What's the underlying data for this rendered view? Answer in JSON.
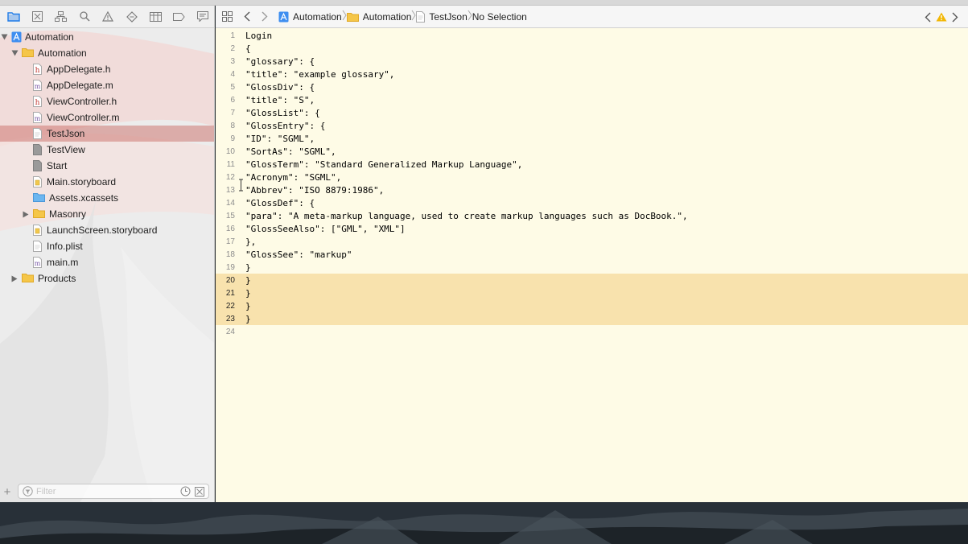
{
  "navigator": {
    "toolbar": [
      "project-navigator-icon",
      "source-control-icon",
      "symbol-navigator-icon",
      "find-icon",
      "issue-warning-icon",
      "test-diamond-icon",
      "debug-icon",
      "breakpoint-icon",
      "report-icon"
    ],
    "tree": [
      {
        "label": "Automation",
        "indent": 0,
        "icon": "project",
        "disclosure": "open"
      },
      {
        "label": "Automation",
        "indent": 1,
        "icon": "folder",
        "disclosure": "open"
      },
      {
        "label": "AppDelegate.h",
        "indent": 2,
        "icon": "h"
      },
      {
        "label": "AppDelegate.m",
        "indent": 2,
        "icon": "m"
      },
      {
        "label": "ViewController.h",
        "indent": 2,
        "icon": "h"
      },
      {
        "label": "ViewController.m",
        "indent": 2,
        "icon": "m"
      },
      {
        "label": "TestJson",
        "indent": 2,
        "icon": "doc",
        "selected": true
      },
      {
        "label": "TestView",
        "indent": 2,
        "icon": "gray"
      },
      {
        "label": "Start",
        "indent": 2,
        "icon": "gray"
      },
      {
        "label": "Main.storyboard",
        "indent": 2,
        "icon": "storyboard"
      },
      {
        "label": "Assets.xcassets",
        "indent": 2,
        "icon": "bluefolder"
      },
      {
        "label": "Masonry",
        "indent": 2,
        "icon": "folder",
        "disclosure": "closed"
      },
      {
        "label": "LaunchScreen.storyboard",
        "indent": 2,
        "icon": "storyboard"
      },
      {
        "label": "Info.plist",
        "indent": 2,
        "icon": "doc"
      },
      {
        "label": "main.m",
        "indent": 2,
        "icon": "m"
      },
      {
        "label": "Products",
        "indent": 1,
        "icon": "folder",
        "disclosure": "closed"
      }
    ],
    "filter": {
      "placeholder": "Filter",
      "add_label": "+"
    }
  },
  "jumpbar": {
    "crumbs": [
      {
        "label": "Automation",
        "icon": "project"
      },
      {
        "label": "Automation",
        "icon": "folder"
      },
      {
        "label": "TestJson",
        "icon": "doc"
      },
      {
        "label": "No Selection",
        "icon": ""
      }
    ]
  },
  "editor": {
    "lines": [
      {
        "n": "1",
        "text": "Login"
      },
      {
        "n": "2",
        "text": "{"
      },
      {
        "n": "3",
        "text": "\"glossary\": {"
      },
      {
        "n": "4",
        "text": "\"title\": \"example glossary\","
      },
      {
        "n": "5",
        "text": "\"GlossDiv\": {"
      },
      {
        "n": "6",
        "text": "\"title\": \"S\","
      },
      {
        "n": "7",
        "text": "\"GlossList\": {"
      },
      {
        "n": "8",
        "text": "\"GlossEntry\": {"
      },
      {
        "n": "9",
        "text": "\"ID\": \"SGML\","
      },
      {
        "n": "10",
        "text": "\"SortAs\": \"SGML\","
      },
      {
        "n": "11",
        "text": "\"GlossTerm\": \"Standard Generalized Markup Language\","
      },
      {
        "n": "12",
        "text": "\"Acronym\": \"SGML\","
      },
      {
        "n": "13",
        "text": "\"Abbrev\": \"ISO 8879:1986\","
      },
      {
        "n": "14",
        "text": "\"GlossDef\": {"
      },
      {
        "n": "15",
        "text": "\"para\": \"A meta-markup language, used to create markup languages such as DocBook.\","
      },
      {
        "n": "16",
        "text": "\"GlossSeeAlso\": [\"GML\", \"XML\"]"
      },
      {
        "n": "17",
        "text": "},"
      },
      {
        "n": "18",
        "text": "\"GlossSee\": \"markup\""
      },
      {
        "n": "19",
        "text": "}"
      },
      {
        "n": "20",
        "text": "}",
        "hl": true
      },
      {
        "n": "21",
        "text": "}",
        "hl": true
      },
      {
        "n": "22",
        "text": "}",
        "hl": true
      },
      {
        "n": "23",
        "text": "}",
        "hl": true
      },
      {
        "n": "24",
        "text": ""
      }
    ]
  },
  "colors": {
    "editor_bg": "#fefbe6",
    "highlight": "#f8e2ad",
    "selection": "#d8928d",
    "folder": "#f5c648",
    "warning": "#f2b705",
    "accent": "#1f7ce8"
  }
}
